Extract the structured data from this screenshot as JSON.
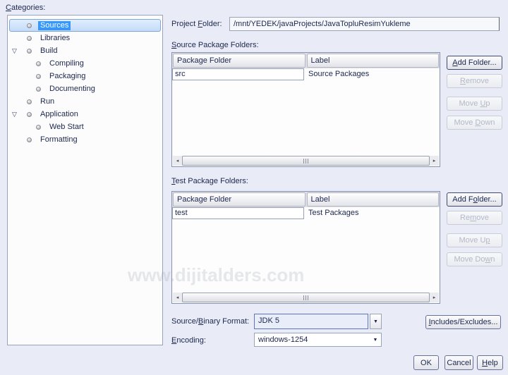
{
  "categories": {
    "label": {
      "label": "Categories:",
      "mn": "C"
    },
    "items": [
      {
        "label": "Sources",
        "level": 1,
        "selected": true
      },
      {
        "label": "Libraries",
        "level": 1
      },
      {
        "label": "Build",
        "level": 1,
        "expanded": true
      },
      {
        "label": "Compiling",
        "level": 2
      },
      {
        "label": "Packaging",
        "level": 2
      },
      {
        "label": "Documenting",
        "level": 2
      },
      {
        "label": "Run",
        "level": 1
      },
      {
        "label": "Application",
        "level": 1,
        "expanded": true
      },
      {
        "label": "Web Start",
        "level": 2
      },
      {
        "label": "Formatting",
        "level": 1
      }
    ]
  },
  "project_folder": {
    "label": {
      "label": "Project Folder:",
      "mn": "F"
    },
    "value": "/mnt/YEDEK/javaProjects/JavaTopluResimYukleme"
  },
  "source_packages": {
    "label": {
      "label": "Source Package Folders:",
      "mn": "S"
    },
    "columns": [
      "Package Folder",
      "Label"
    ],
    "rows": [
      [
        "src",
        "Source Packages"
      ]
    ],
    "buttons": [
      {
        "label": "Add Folder...",
        "mn": "A",
        "enabled": true
      },
      {
        "label": "Remove",
        "mn": "R",
        "enabled": false
      },
      {
        "label": "Move Up",
        "mn": "U",
        "enabled": false
      },
      {
        "label": "Move Down",
        "mn": "D",
        "enabled": false
      }
    ]
  },
  "test_packages": {
    "label": {
      "label": "Test Package Folders:",
      "mn": "T"
    },
    "columns": [
      "Package Folder",
      "Label"
    ],
    "rows": [
      [
        "test",
        "Test Packages"
      ]
    ],
    "buttons": [
      {
        "label": "Add Folder...",
        "mn": "o",
        "enabled": true
      },
      {
        "label": "Remove",
        "mn": "m",
        "enabled": false
      },
      {
        "label": "Move Up",
        "mn": "p",
        "enabled": false
      },
      {
        "label": "Move Down",
        "mn": "w",
        "enabled": false
      }
    ]
  },
  "format_row": {
    "label": {
      "label": "Source/Binary Format:",
      "mn": "B"
    },
    "value": "JDK 5"
  },
  "encoding_row": {
    "label": {
      "label": "Encoding:",
      "mn": "E"
    },
    "value": "windows-1254"
  },
  "includes_excludes": {
    "label": "Includes/Excludes...",
    "mn": "I"
  },
  "footer": {
    "ok": "OK",
    "cancel": "Cancel",
    "help": {
      "label": "Help",
      "mn": "H"
    }
  },
  "icons": {
    "expander_open": "▽",
    "scroll_left": "◂",
    "scroll_right": "▸",
    "combo_arrow": "▼"
  },
  "watermark": "www.dijitalders.com",
  "colors": {
    "dialog_bg": "#e9ecf6",
    "selection_blue": "#3697fd",
    "selection_row_border": "#7ea6d8",
    "text": "#1c274e",
    "disabled_text": "#b4b9c6",
    "panel_border": "#95a3bd"
  }
}
